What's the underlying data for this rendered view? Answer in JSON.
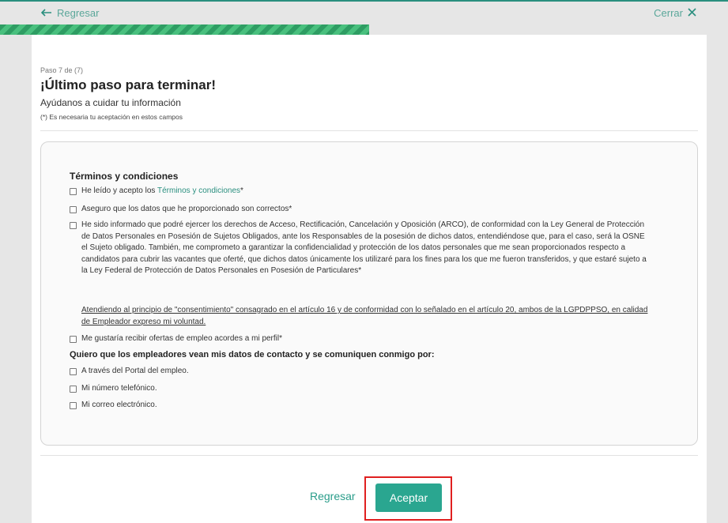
{
  "header": {
    "back_label": "Regresar",
    "close_label": "Cerrar",
    "progress_fraction": 0.507,
    "accent_color": "#2a8f7f",
    "progress_color": "#49c07e"
  },
  "form": {
    "step": "Paso 7 de (7)",
    "title": "¡Último paso para terminar!",
    "subtitle": "Ayúdanos a cuidar tu información",
    "required_note": "(*) Es necesaria tu aceptación en estos campos"
  },
  "terms": {
    "heading": "Términos y condiciones",
    "read_accept_prefix": "He leído y acepto los ",
    "read_accept_link": "Términos y condiciones",
    "read_accept_suffix": "*",
    "data_correct": "Aseguro que los datos que he proporcionado son correctos*",
    "arco": "He sido informado que podré ejercer los derechos de Acceso, Rectificación, Cancelación y Oposición (ARCO), de conformidad con la Ley General de Protección de Datos Personales en Posesión de Sujetos Obligados, ante los Responsables de la posesión de dichos datos, entendiéndose que, para el caso, será la OSNE el Sujeto obligado. También, me comprometo a garantizar la confidencialidad y protección de los datos personales que me sean proporcionados respecto a candidatos para cubrir las vacantes que oferté, que dichos datos únicamente los utilizaré para los fines para los que me fueron transferidos, y que estaré sujeto a la Ley Federal de Protección de Datos Personales en Posesión de Particulares*",
    "consent": "Atendiendo al principio de \"consentimiento\" consagrado en el artículo 16 y de conformidad con lo señalado en el artículo 20, ambos de la LGPDPPSO, en calidad de Empleador expreso mi voluntad.",
    "offers": "Me gustaría recibir ofertas de empleo acordes a mi perfil*"
  },
  "contact": {
    "heading": "Quiero que los empleadores vean mis datos de contacto y se comuniquen conmigo por:",
    "options": [
      "A través del Portal del empleo.",
      "Mi número telefónico.",
      "Mi correo electrónico."
    ]
  },
  "footer": {
    "back_label": "Regresar",
    "accept_label": "Aceptar",
    "highlight_color": "#e02020"
  }
}
